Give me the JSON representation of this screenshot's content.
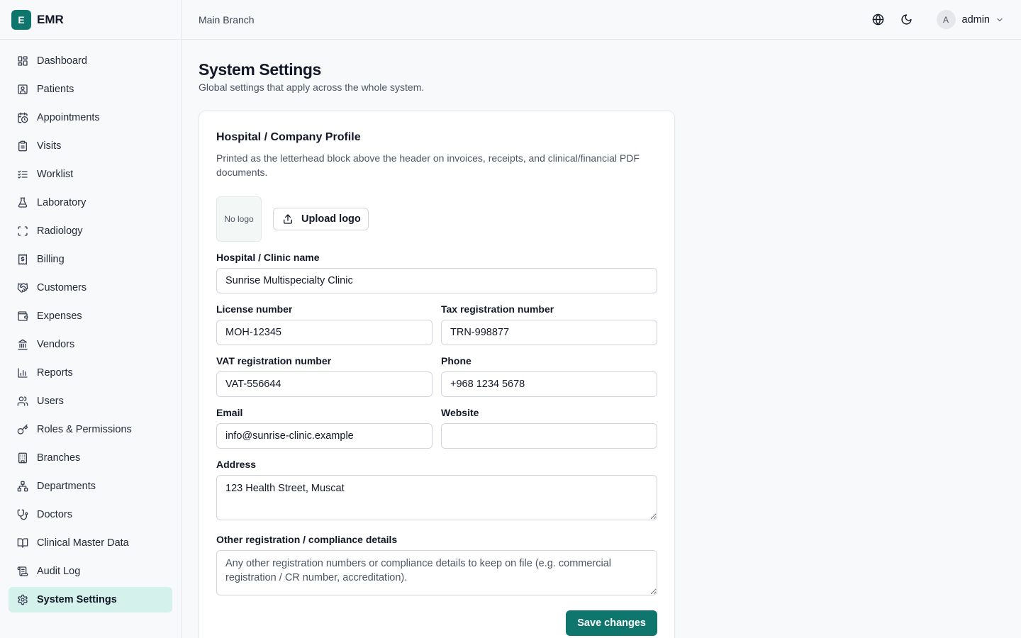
{
  "app": {
    "brand_letter": "E",
    "brand_name": "EMR"
  },
  "sidebar": {
    "items": [
      {
        "label": "Dashboard",
        "icon": "dashboard-icon"
      },
      {
        "label": "Patients",
        "icon": "patient-card-icon"
      },
      {
        "label": "Appointments",
        "icon": "calendar-clock-icon"
      },
      {
        "label": "Visits",
        "icon": "clipboard-icon"
      },
      {
        "label": "Worklist",
        "icon": "list-checks-icon"
      },
      {
        "label": "Laboratory",
        "icon": "flask-icon"
      },
      {
        "label": "Radiology",
        "icon": "scan-icon"
      },
      {
        "label": "Billing",
        "icon": "receipt-icon"
      },
      {
        "label": "Customers",
        "icon": "handshake-icon"
      },
      {
        "label": "Expenses",
        "icon": "wallet-icon"
      },
      {
        "label": "Vendors",
        "icon": "bank-icon"
      },
      {
        "label": "Reports",
        "icon": "bar-chart-icon"
      },
      {
        "label": "Users",
        "icon": "users-icon"
      },
      {
        "label": "Roles & Permissions",
        "icon": "key-icon"
      },
      {
        "label": "Branches",
        "icon": "building-icon"
      },
      {
        "label": "Departments",
        "icon": "network-icon"
      },
      {
        "label": "Doctors",
        "icon": "stethoscope-icon"
      },
      {
        "label": "Clinical Master Data",
        "icon": "book-icon"
      },
      {
        "label": "Audit Log",
        "icon": "scroll-icon"
      },
      {
        "label": "System Settings",
        "icon": "gear-icon",
        "active": true
      }
    ]
  },
  "header": {
    "branch": "Main Branch",
    "user_initial": "A",
    "user_name": "admin"
  },
  "page": {
    "title": "System Settings",
    "subtitle": "Global settings that apply across the whole system."
  },
  "card": {
    "title": "Hospital / Company Profile",
    "description": "Printed as the letterhead block above the header on invoices, receipts, and clinical/financial PDF documents.",
    "logo_placeholder": "No logo",
    "upload_label": "Upload logo",
    "fields": {
      "name": {
        "label": "Hospital / Clinic name",
        "value": "Sunrise Multispecialty Clinic"
      },
      "license": {
        "label": "License number",
        "value": "MOH-12345"
      },
      "tax": {
        "label": "Tax registration number",
        "value": "TRN-998877"
      },
      "vat": {
        "label": "VAT registration number",
        "value": "VAT-556644"
      },
      "phone": {
        "label": "Phone",
        "value": "+968 1234 5678"
      },
      "email": {
        "label": "Email",
        "value": "info@sunrise-clinic.example"
      },
      "website": {
        "label": "Website",
        "value": ""
      },
      "address": {
        "label": "Address",
        "value": "123 Health Street, Muscat"
      },
      "other": {
        "label": "Other registration / compliance details",
        "value": "",
        "placeholder": "Any other registration numbers or compliance details to keep on file (e.g. commercial registration / CR number, accreditation)."
      }
    },
    "save_label": "Save changes"
  },
  "colors": {
    "accent": "#0f766e",
    "active_nav_bg": "#d5f1ec"
  }
}
